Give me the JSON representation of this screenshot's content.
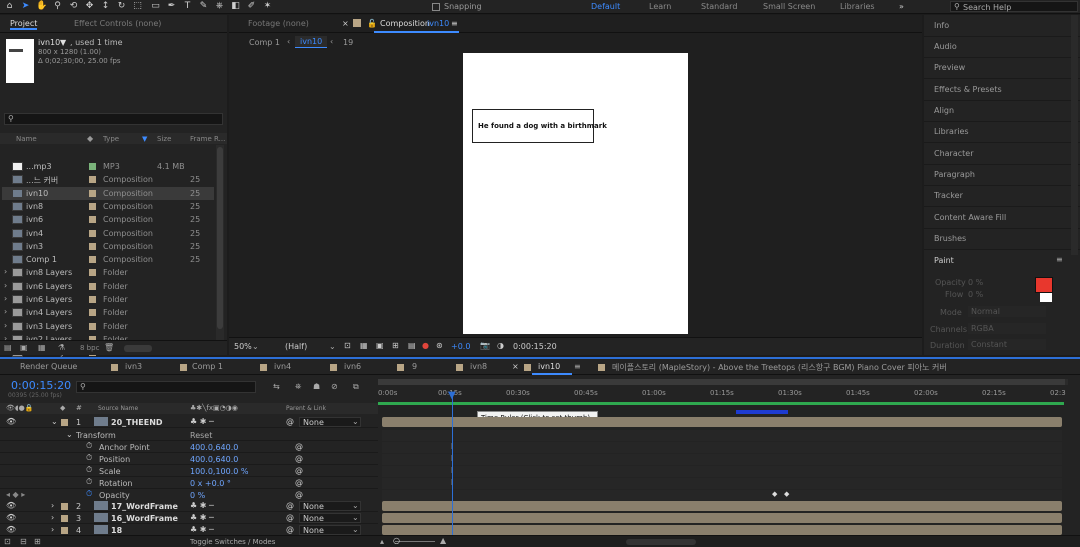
{
  "toolbar": {
    "snapping_label": "Snapping",
    "workspaces": [
      "Default",
      "Learn",
      "Standard",
      "Small Screen",
      "Libraries"
    ],
    "overflow": "»",
    "search_placeholder": "Search Help"
  },
  "project": {
    "tab_project": "Project",
    "tab_effect_controls": "Effect Controls (none)",
    "selected_name": "ivn10",
    "used": ", used 1 time",
    "dims": "800 x 1280 (1.00)",
    "duration": "Δ 0;02;30;00, 25.00 fps",
    "columns": {
      "name": "Name",
      "type": "Type",
      "size": "Size",
      "frame": "Frame R..."
    },
    "rows": [
      {
        "name": "...mp3",
        "type": "MP3",
        "size": "4.1 MB",
        "frame": ""
      },
      {
        "name": "...느 커버",
        "type": "Composition",
        "size": "",
        "frame": "25"
      },
      {
        "name": "ivn10",
        "type": "Composition",
        "size": "",
        "frame": "25"
      },
      {
        "name": "ivn8",
        "type": "Composition",
        "size": "",
        "frame": "25"
      },
      {
        "name": "ivn6",
        "type": "Composition",
        "size": "",
        "frame": "25"
      },
      {
        "name": "ivn4",
        "type": "Composition",
        "size": "",
        "frame": "25"
      },
      {
        "name": "ivn3",
        "type": "Composition",
        "size": "",
        "frame": "25"
      },
      {
        "name": "Comp 1",
        "type": "Composition",
        "size": "",
        "frame": "25"
      },
      {
        "name": "ivn8 Layers",
        "type": "Folder",
        "size": "",
        "frame": ""
      },
      {
        "name": "ivn6 Layers",
        "type": "Folder",
        "size": "",
        "frame": ""
      },
      {
        "name": "ivn6 Layers",
        "type": "Folder",
        "size": "",
        "frame": ""
      },
      {
        "name": "ivn4 Layers",
        "type": "Folder",
        "size": "",
        "frame": ""
      },
      {
        "name": "ivn3 Layers",
        "type": "Folder",
        "size": "",
        "frame": ""
      },
      {
        "name": "ivn2 Layers",
        "type": "Folder",
        "size": "",
        "frame": ""
      },
      {
        "name": "ivn10 Layers",
        "type": "Folder",
        "size": "",
        "frame": ""
      }
    ],
    "bpc": "8 bpc"
  },
  "composition": {
    "tab_footage": "Footage (none)",
    "tab_comp_prefix": "Composition",
    "tab_comp_name": "ivn10",
    "crumb_comp1": "Comp 1",
    "crumb_ivn10": "ivn10",
    "crumb_19": "19",
    "caption_text": "He found a dog with a birthmark",
    "zoom": "50%",
    "resolution": "(Half)",
    "exposure": "+0.0",
    "timecode": "0:00:15:20"
  },
  "right_panel": {
    "items": [
      "Info",
      "Audio",
      "Preview",
      "Effects & Presets",
      "Align",
      "Libraries",
      "Character",
      "Paragraph",
      "Tracker",
      "Content Aware Fill",
      "Brushes"
    ],
    "paint_title": "Paint",
    "opacity_label": "Opacity",
    "opacity_value": "0 %",
    "flow_label": "Flow",
    "flow_value": "0 %",
    "mode_label": "Mode",
    "mode_value": "Normal",
    "channels_label": "Channels",
    "channels_value": "RGBA",
    "duration_label": "Duration",
    "duration_value": "Constant",
    "fg_color": "#e8372d",
    "bg_color": "#ffffff"
  },
  "timeline": {
    "tabs": [
      "Render Queue",
      "ivn3",
      "Comp 1",
      "ivn4",
      "ivn6",
      "9",
      "ivn8",
      "ivn10",
      "메이플스토리 (MapleStory) - Above the Treetops (리스항구 BGM) Piano Cover 피아노 커버"
    ],
    "timecode": "0:00:15:20",
    "subcode": "00395 (25.00 fps)",
    "col_source": "Source Name",
    "col_parent": "Parent & Link",
    "ruler": [
      "0:00s",
      "00:15s",
      "00:30s",
      "00:45s",
      "01:00s",
      "01:15s",
      "01:30s",
      "01:45s",
      "02:00s",
      "02:15s",
      "02:3"
    ],
    "tooltip": "Time Ruler (Click to set thumb)",
    "layer1": {
      "num": "1",
      "name": "20_THEEND",
      "parent": "None"
    },
    "transform_label": "Transform",
    "reset_label": "Reset",
    "props": [
      {
        "name": "Anchor Point",
        "value": "400.0,640.0"
      },
      {
        "name": "Position",
        "value": "400.0,640.0"
      },
      {
        "name": "Scale",
        "value": "100.0,100.0 %"
      },
      {
        "name": "Rotation",
        "value": "0 x +0.0 °"
      },
      {
        "name": "Opacity",
        "value": "0 %"
      }
    ],
    "layers": [
      {
        "num": "2",
        "name": "17_WordFrame",
        "parent": "None"
      },
      {
        "num": "3",
        "name": "16_WordFrame",
        "parent": "None"
      },
      {
        "num": "4",
        "name": "18",
        "parent": "None"
      }
    ],
    "toggle_label": "Toggle Switches / Modes"
  }
}
